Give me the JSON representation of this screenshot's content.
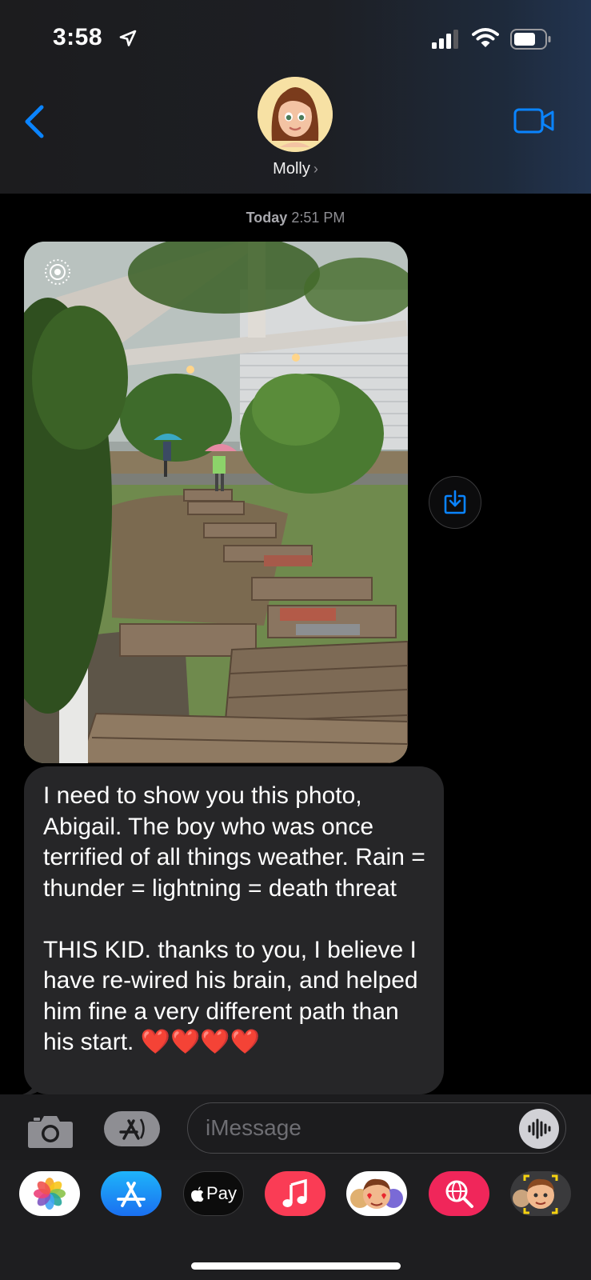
{
  "status_bar": {
    "time": "3:58"
  },
  "contact": {
    "name": "Molly",
    "chevron": "›"
  },
  "conversation": {
    "timestamp_day": "Today",
    "timestamp_time": "2:51 PM",
    "message_text": "I need to show you this photo, Abigail. The boy who was once terrified of all things weather. Rain = thunder = lightning = death threat\n\nTHIS KID. thanks to you, I believe I have re-wired his brain, and helped him fine a very different path than his start. ❤️❤️❤️❤️"
  },
  "input": {
    "placeholder": "iMessage"
  },
  "app_drawer": {
    "apple_pay_label": "Pay"
  },
  "icons": {
    "back": "chevron-left-icon",
    "video": "video-camera-icon",
    "camera": "camera-icon",
    "apps": "app-store-icon",
    "audio": "waveform-icon",
    "save": "save-download-icon",
    "live_photo": "live-photo-icon"
  },
  "colors": {
    "accent": "#0a84ff",
    "bubble": "#262628",
    "background": "#000000"
  }
}
